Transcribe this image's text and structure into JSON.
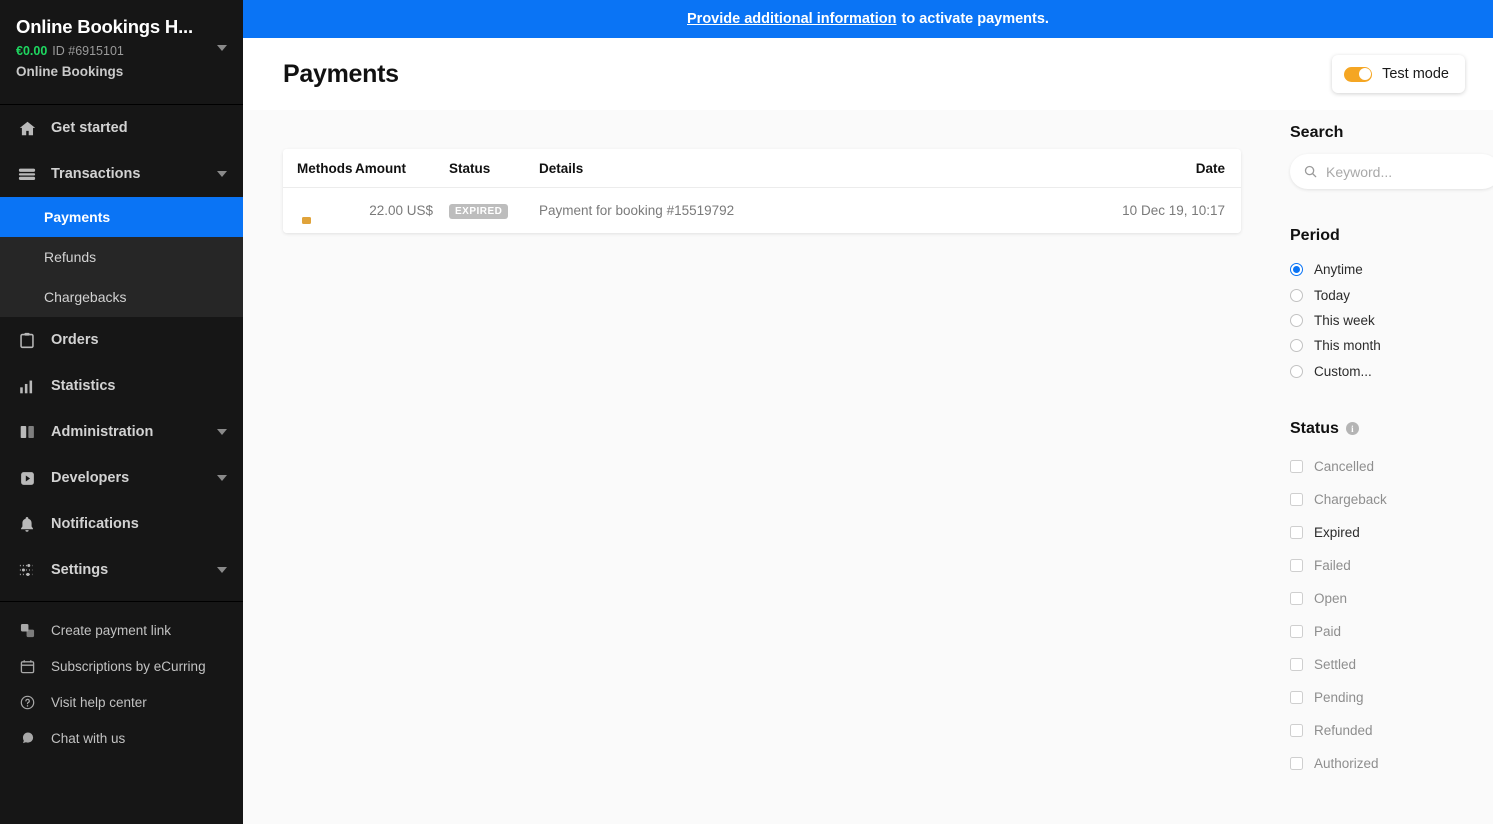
{
  "sidebar": {
    "brand": {
      "title": "Online Bookings H...",
      "amount": "€0.00",
      "id": "ID #6915101",
      "account": "Online Bookings"
    },
    "items": [
      {
        "label": "Get started",
        "icon": "home-icon",
        "caret": false
      },
      {
        "label": "Transactions",
        "icon": "transactions-icon",
        "caret": true
      },
      {
        "label": "Orders",
        "icon": "orders-icon",
        "caret": false
      },
      {
        "label": "Statistics",
        "icon": "statistics-icon",
        "caret": false
      },
      {
        "label": "Administration",
        "icon": "administration-icon",
        "caret": true
      },
      {
        "label": "Developers",
        "icon": "developers-icon",
        "caret": true
      },
      {
        "label": "Notifications",
        "icon": "bell-icon",
        "caret": false
      },
      {
        "label": "Settings",
        "icon": "settings-icon",
        "caret": true
      }
    ],
    "submenu": [
      {
        "label": "Payments",
        "active": true
      },
      {
        "label": "Refunds",
        "active": false
      },
      {
        "label": "Chargebacks",
        "active": false
      }
    ],
    "bottom": [
      {
        "label": "Create payment link",
        "icon": "payment-link-icon"
      },
      {
        "label": "Subscriptions by eCurring",
        "icon": "calendar-icon"
      },
      {
        "label": "Visit help center",
        "icon": "help-circle-icon"
      },
      {
        "label": "Chat with us",
        "icon": "chat-icon"
      }
    ],
    "colors": {
      "background": "#161616",
      "submenu_background": "#262626",
      "active": "#0a74f5",
      "amount": "#1ed760"
    }
  },
  "banner": {
    "link": "Provide additional information",
    "rest": "to activate payments.",
    "color": "#0a74f5"
  },
  "header": {
    "title": "Payments",
    "test_mode_label": "Test mode",
    "test_mode_on": true,
    "toggle_color": "#f5a623"
  },
  "table": {
    "columns": [
      "Methods",
      "Amount",
      "Status",
      "Details",
      "Date"
    ],
    "rows": [
      {
        "method_icon": "credit-card-icon",
        "amount": "22.00 US$",
        "status": "EXPIRED",
        "details": "Payment for booking #15519792",
        "date": "10 Dec 19, 10:17"
      }
    ]
  },
  "filters": {
    "search": {
      "title": "Search",
      "placeholder": "Keyword...",
      "value": "",
      "icon": "search-icon"
    },
    "period": {
      "title": "Period",
      "options": [
        {
          "label": "Anytime",
          "selected": true
        },
        {
          "label": "Today",
          "selected": false
        },
        {
          "label": "This week",
          "selected": false
        },
        {
          "label": "This month",
          "selected": false
        },
        {
          "label": "Custom...",
          "selected": false
        }
      ]
    },
    "status": {
      "title": "Status",
      "info_icon": "info-icon",
      "options": [
        {
          "label": "Cancelled",
          "checked": false,
          "highlighted": false
        },
        {
          "label": "Chargeback",
          "checked": false,
          "highlighted": false
        },
        {
          "label": "Expired",
          "checked": false,
          "highlighted": true
        },
        {
          "label": "Failed",
          "checked": false,
          "highlighted": false
        },
        {
          "label": "Open",
          "checked": false,
          "highlighted": false
        },
        {
          "label": "Paid",
          "checked": false,
          "highlighted": false
        },
        {
          "label": "Settled",
          "checked": false,
          "highlighted": false
        },
        {
          "label": "Pending",
          "checked": false,
          "highlighted": false
        },
        {
          "label": "Refunded",
          "checked": false,
          "highlighted": false
        },
        {
          "label": "Authorized",
          "checked": false,
          "highlighted": false
        }
      ]
    }
  }
}
